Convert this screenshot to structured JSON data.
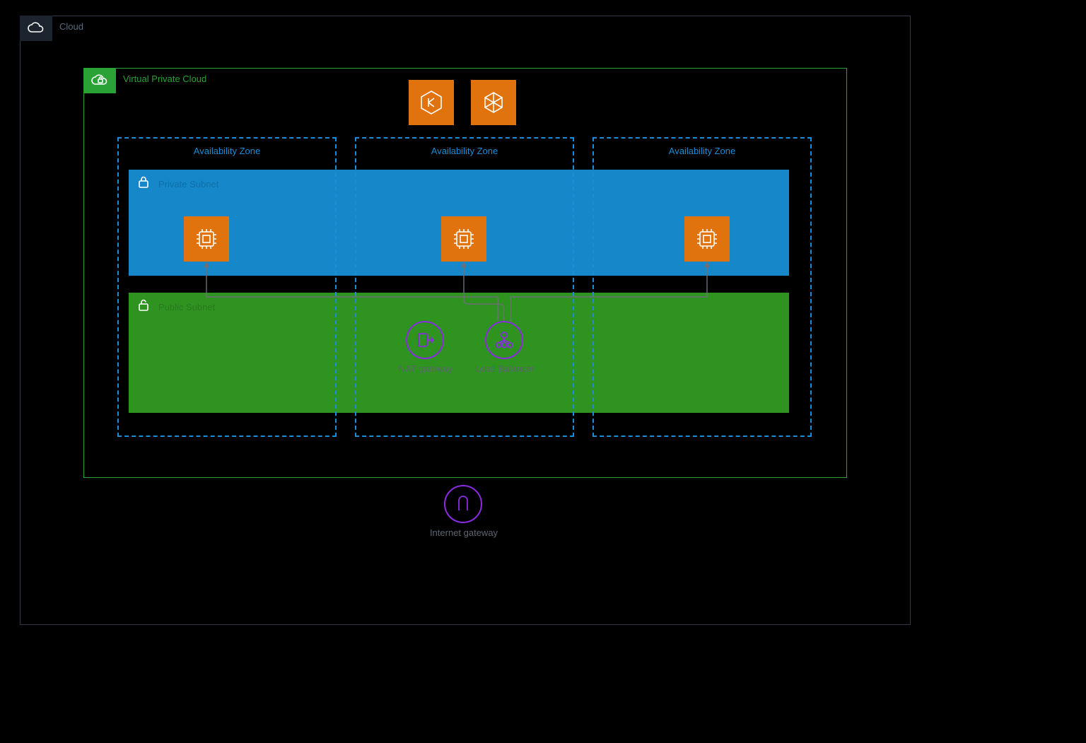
{
  "cloud": {
    "label": "Cloud"
  },
  "vpc": {
    "label": "Virtual Private Cloud"
  },
  "az": {
    "label1": "Availability Zone",
    "label2": "Availability Zone",
    "label3": "Availability Zone"
  },
  "subnets": {
    "private_label": "Private Subnet",
    "public_label": "Public Subnet"
  },
  "services": {
    "top1_name": "eks-service-icon",
    "top2_name": "ec2-service-icon"
  },
  "nat": {
    "label": "NAT gateway"
  },
  "lb": {
    "label": "Load Balancer"
  },
  "igw": {
    "label": "Internet gateway"
  },
  "colors": {
    "cloud_border": "#2f3b4a",
    "vpc_green": "#2aa236",
    "az_blue": "#1c8cd6",
    "private_blue": "#1687c9",
    "public_green": "#2f931f",
    "orange": "#e1730f",
    "purple": "#8a2be2",
    "text_muted": "#5d6570"
  }
}
